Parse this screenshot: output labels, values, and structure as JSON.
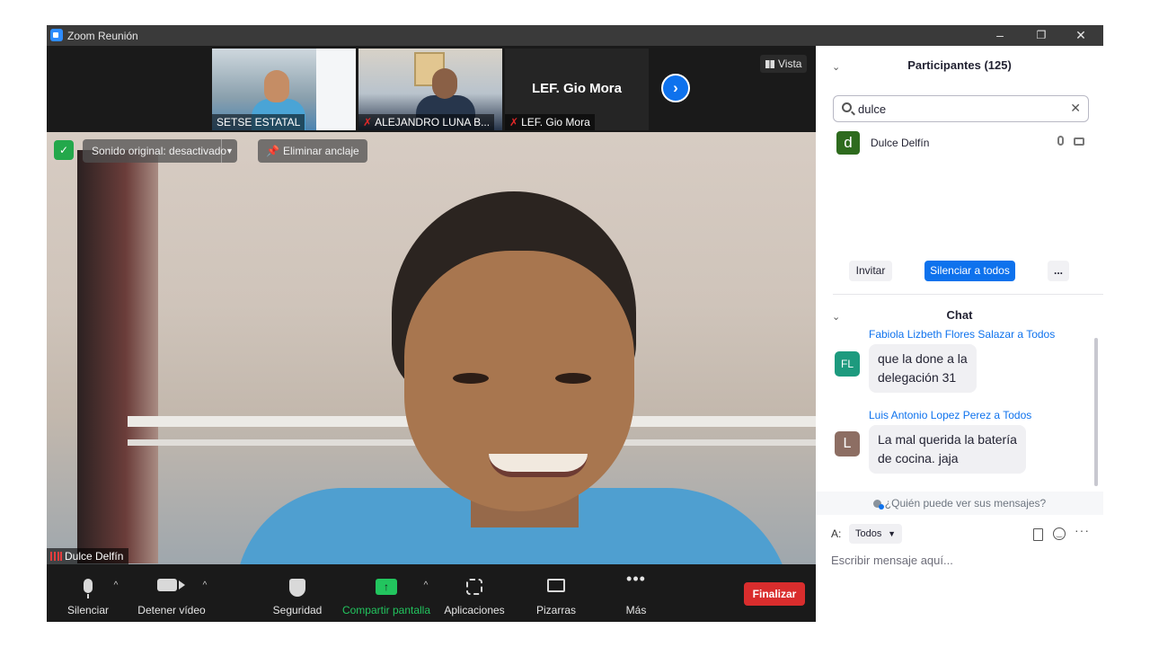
{
  "window": {
    "title": "Zoom Reunión",
    "minimize": "–",
    "maximize": "❐",
    "close": "✕"
  },
  "thumbnails": [
    {
      "name": "SETSE ESTATAL",
      "muted": false
    },
    {
      "name": "ALEJANDRO LUNA B...",
      "muted": true
    },
    {
      "name": "LEF. Gio Mora",
      "muted": true,
      "display_name": "LEF. Gio Mora"
    }
  ],
  "view_button": "Vista",
  "next_icon": "›",
  "main_video": {
    "audio_toggle": "Sonido original: desactivado",
    "unpin": "Eliminar anclaje",
    "speaker_name": "Dulce Delfín"
  },
  "toolbar": {
    "mute": "Silenciar",
    "video": "Detener vídeo",
    "security": "Seguridad",
    "share": "Compartir pantalla",
    "apps": "Aplicaciones",
    "boards": "Pizarras",
    "more": "Más",
    "end": "Finalizar",
    "caret": "^",
    "more_icon": "•••"
  },
  "participants": {
    "title": "Participantes (125)",
    "search_value": "dulce",
    "results": [
      {
        "initial": "d",
        "name": "Dulce Delfín",
        "avatar_color": "#2e6b1e"
      }
    ],
    "invite": "Invitar",
    "mute_all": "Silenciar a todos",
    "more": "..."
  },
  "chat": {
    "title": "Chat",
    "messages": [
      {
        "sender": "Fabiola Lizbeth Flores Salazar a Todos",
        "initials": "FL",
        "avatar_color": "#1d9a7e",
        "text_lines": [
          "que la done a la",
          "delegación 31"
        ]
      },
      {
        "sender": "Luis Antonio Lopez Perez a Todos",
        "initials": "L",
        "avatar_color": "#8d6e63",
        "text_lines": [
          "La mal querida la batería",
          "de cocina. jaja"
        ]
      }
    ],
    "who_can_see": "¿Quién puede ver sus mensajes?",
    "to_label": "A:",
    "recipient": "Todos",
    "input_placeholder": "Escribir mensaje aquí..."
  },
  "colors": {
    "accent": "#0e72ed",
    "end": "#d92d2d",
    "share": "#22c55e",
    "security": "#23a84b"
  }
}
